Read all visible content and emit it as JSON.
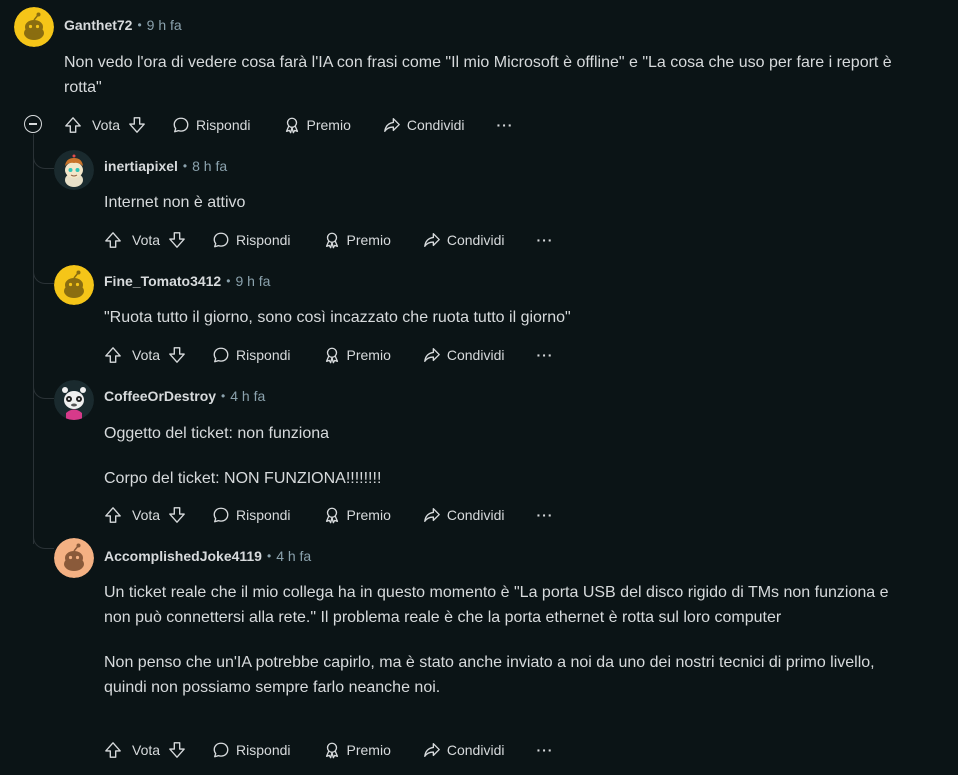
{
  "actions": {
    "vote": "Vota",
    "reply": "Rispondi",
    "award": "Premio",
    "share": "Condividi",
    "more": "···"
  },
  "meta_separator": "•",
  "comments": [
    {
      "author": "Ganthet72",
      "time": "9 h fa",
      "body": [
        "Non vedo l'ora di vedere cosa farà l'IA con frasi come \"Il mio Microsoft è offline\" e \"La cosa che uso per fare i report è rotta\""
      ]
    },
    {
      "author": "inertiapixel",
      "time": "8 h fa",
      "body": [
        "Internet non è attivo"
      ]
    },
    {
      "author": "Fine_Tomato3412",
      "time": "9 h fa",
      "body": [
        "\"Ruota tutto il giorno, sono così incazzato che ruota tutto il giorno\""
      ]
    },
    {
      "author": "CoffeeOrDestroy",
      "time": "4 h fa",
      "body": [
        "Oggetto del ticket: non funziona",
        "Corpo del ticket: NON FUNZIONA!!!!!!!!"
      ]
    },
    {
      "author": "AccomplishedJoke4119",
      "time": "4 h fa",
      "body": [
        "Un ticket reale che il mio collega ha in questo momento è \"La porta USB del disco rigido di TMs non funziona e non può connettersi alla rete.\" Il problema reale è che la porta ethernet è rotta sul loro computer",
        "Non penso che un'IA potrebbe capirlo, ma è stato anche inviato a noi da uno dei nostri tecnici di primo livello, quindi non possiamo sempre farlo neanche noi."
      ]
    }
  ],
  "colors": {
    "background": "#0b1416",
    "text": "#d7dadc",
    "meta": "#8ba2ad",
    "thread_line": "#2a3236",
    "avatar_yellow": "#f5c518",
    "avatar_orange": "#f4b183"
  }
}
